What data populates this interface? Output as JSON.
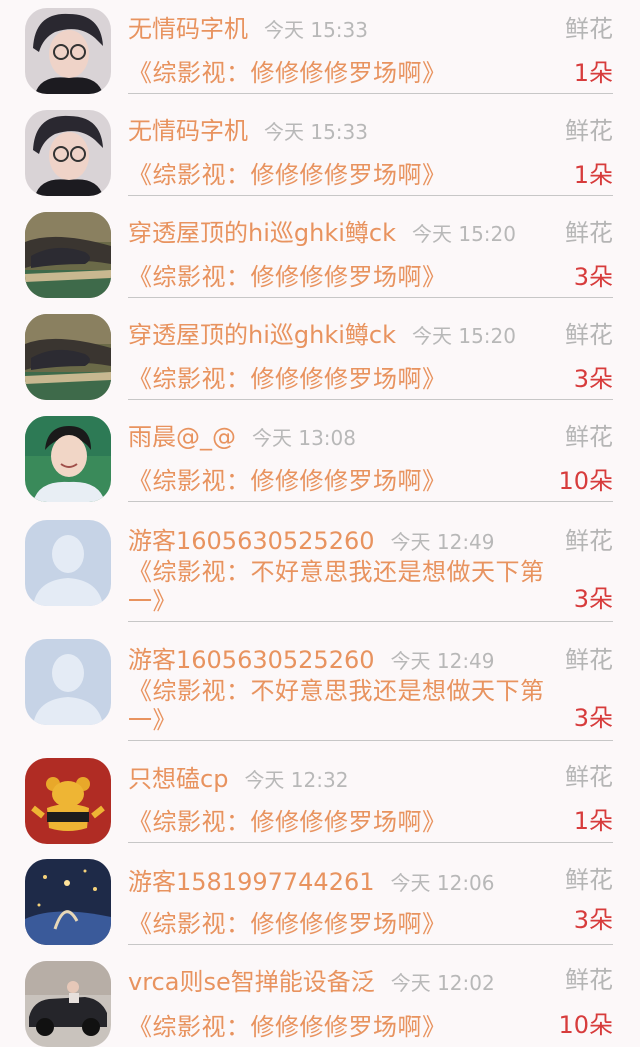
{
  "gift_type": "鲜花",
  "rows": [
    {
      "name": "无情码字机",
      "time": "今天 15:33",
      "work": "《综影视：修修修修罗场啊》",
      "count": "1朵",
      "avatar": "avatar-photo-man-glasses"
    },
    {
      "name": "无情码字机",
      "time": "今天 15:33",
      "work": "《综影视：修修修修罗场啊》",
      "count": "1朵",
      "avatar": "avatar-photo-man-glasses"
    },
    {
      "name": "穿透屋顶的hi巡ghki鳟ck",
      "time": "今天 15:20",
      "work": "《综影视：修修修修罗场啊》",
      "count": "3朵",
      "avatar": "avatar-photo-outdoor-scene"
    },
    {
      "name": "穿透屋顶的hi巡ghki鳟ck",
      "time": "今天 15:20",
      "work": "《综影视：修修修修罗场啊》",
      "count": "3朵",
      "avatar": "avatar-photo-outdoor-scene"
    },
    {
      "name": "雨晨@_@",
      "time": "今天 13:08",
      "work": "《综影视：修修修修罗场啊》",
      "count": "10朵",
      "avatar": "avatar-photo-smiling-man"
    },
    {
      "name": "游客1605630525260",
      "time": "今天 12:49",
      "work": "《综影视：不好意思我还是想做天下第一》",
      "count": "3朵",
      "avatar": "avatar-default-silhouette"
    },
    {
      "name": "游客1605630525260",
      "time": "今天 12:49",
      "work": "《综影视：不好意思我还是想做天下第一》",
      "count": "3朵",
      "avatar": "avatar-default-silhouette"
    },
    {
      "name": "只想磕cp",
      "time": "今天 12:32",
      "work": "《综影视：修修修修罗场啊》",
      "count": "1朵",
      "avatar": "avatar-cartoon-bear"
    },
    {
      "name": "游客1581997744261",
      "time": "今天 12:06",
      "work": "《综影视：修修修修罗场啊》",
      "count": "3朵",
      "avatar": "avatar-photo-night-sky"
    },
    {
      "name": "vrca则se智掸能设备泛",
      "time": "今天 12:02",
      "work": "《综影视：修修修修罗场啊》",
      "count": "10朵",
      "avatar": "avatar-photo-car"
    }
  ]
}
